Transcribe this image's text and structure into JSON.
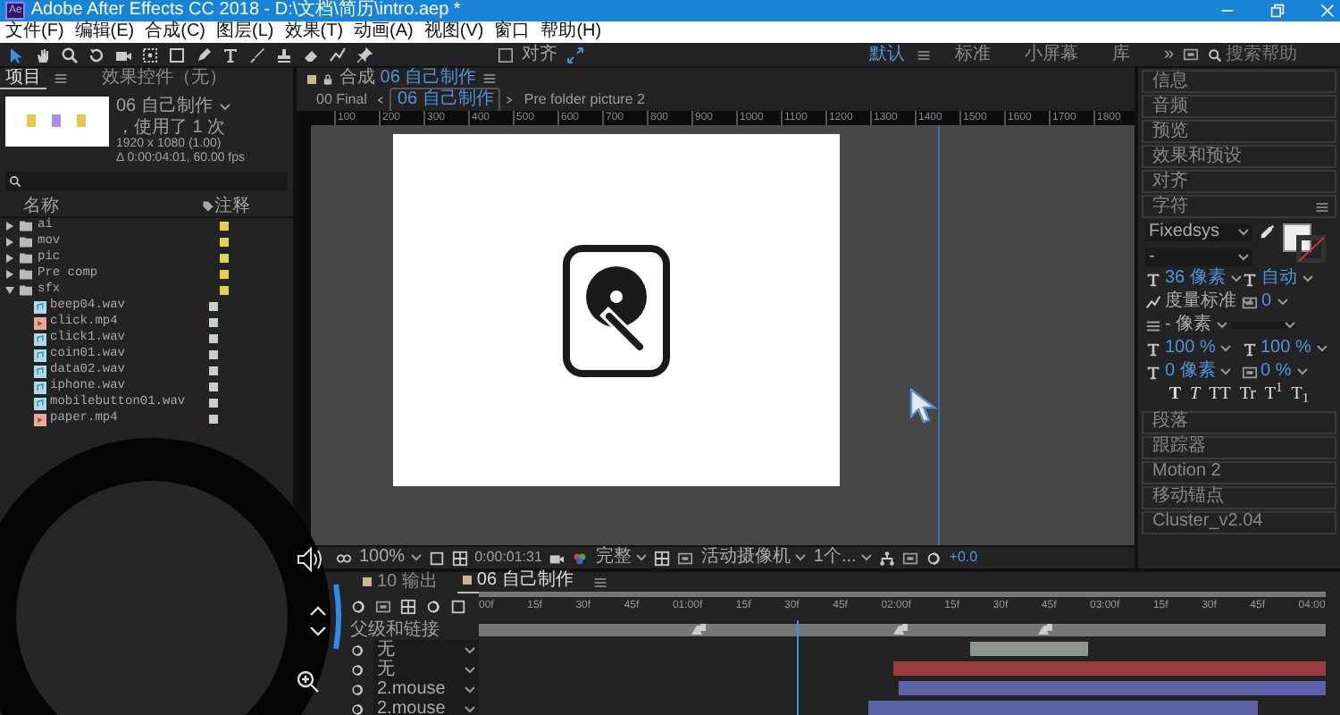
{
  "window": {
    "app_icon": "Ae",
    "title": "Adobe After Effects CC 2018 - D:\\文档\\简历\\intro.aep *"
  },
  "menu": [
    "文件(F)",
    "编辑(E)",
    "合成(C)",
    "图层(L)",
    "效果(T)",
    "动画(A)",
    "视图(V)",
    "窗口",
    "帮助(H)"
  ],
  "toolbar": {
    "snap": {
      "label": "对齐",
      "checked": false
    },
    "workspaces": [
      {
        "label": "默认",
        "selected": true
      },
      {
        "label": "标准",
        "selected": false
      },
      {
        "label": "小屏幕",
        "selected": false
      },
      {
        "label": "库",
        "selected": false
      }
    ],
    "more": "»",
    "search": {
      "placeholder": "搜索帮助"
    }
  },
  "project_panel": {
    "tabs": [
      {
        "label": "项目",
        "selected": true
      },
      {
        "label": "效果控件（无）",
        "selected": false
      }
    ],
    "info": {
      "name": "06 自己制作",
      "usage": "，使用了 1 次",
      "size": "1920 x 1080 (1.00)",
      "duration": "Δ 0:00:04:01, 60.00 fps"
    },
    "columns": [
      "名称",
      "注释"
    ],
    "items": [
      {
        "name": "ai",
        "kind": "folder",
        "expanded": false,
        "color": "#e0d24a"
      },
      {
        "name": "mov",
        "kind": "folder",
        "expanded": false,
        "color": "#e0d24a"
      },
      {
        "name": "pic",
        "kind": "folder",
        "expanded": false,
        "color": "#e0d24a"
      },
      {
        "name": "Pre comp",
        "kind": "folder",
        "expanded": false,
        "color": "#e0d24a"
      },
      {
        "name": "sfx",
        "kind": "folder",
        "expanded": true,
        "color": "#e0d24a",
        "children": [
          {
            "name": "beep04.wav",
            "kind": "audio",
            "color": "#c4d0d0"
          },
          {
            "name": "click.mp4",
            "kind": "video",
            "color": "#c4d0d0"
          },
          {
            "name": "click1.wav",
            "kind": "audio",
            "color": "#c4d0d0"
          },
          {
            "name": "coin01.wav",
            "kind": "audio",
            "color": "#c4d0d0"
          },
          {
            "name": "data02.wav",
            "kind": "audio",
            "color": "#c4d0d0"
          },
          {
            "name": "iphone.wav",
            "kind": "audio",
            "color": "#c4d0d0"
          },
          {
            "name": "mobilebutton01.wav",
            "kind": "audio",
            "color": "#c4d0d0"
          },
          {
            "name": "paper.mp4",
            "kind": "video",
            "color": "#c4d0d0"
          }
        ]
      }
    ]
  },
  "composition": {
    "tab": {
      "prefix": "合成",
      "name": "06 自己制作"
    },
    "breadcrumbs": [
      {
        "label": "00 Final",
        "selected": false
      },
      {
        "label": "06 自己制作",
        "selected": true
      },
      {
        "label": "Pre folder picture 2",
        "selected": false
      }
    ],
    "ruler": [
      "100",
      "200",
      "300",
      "400",
      "500",
      "600",
      "700",
      "800",
      "900",
      "1000",
      "1100",
      "1200",
      "1300",
      "1400",
      "1500",
      "1600",
      "1700",
      "1800"
    ],
    "viewer_toolbar": {
      "zoom": "100%",
      "time": "0:00:01:31",
      "resolution": "完整",
      "camera": "活动摄像机",
      "views": "1个...",
      "exposure": "+0.0"
    }
  },
  "right_panel": {
    "panels_before": [
      "信息",
      "音频",
      "预览",
      "效果和预设",
      "对齐"
    ],
    "character": {
      "title": "字符",
      "font": "Fixedsys",
      "style": "-",
      "size": "36 像素",
      "leading": "自动",
      "kerning": "度量标准",
      "tracking": "0",
      "stroke_width": "- 像素",
      "vertical_scale": "100 %",
      "horizontal_scale": "100 %",
      "baseline_shift": "0 像素",
      "tsume": "0 %",
      "style_buttons": [
        {
          "label": "T",
          "kind": "bold"
        },
        {
          "label": "T",
          "kind": "italic"
        },
        {
          "label": "TT",
          "kind": "plain"
        },
        {
          "label": "Tr",
          "kind": "plain"
        },
        {
          "label": "T$^{1}$",
          "kind": "plain"
        },
        {
          "label": "T$_{1}$",
          "kind": "plain"
        }
      ]
    },
    "panels_after": [
      "段落",
      "跟踪器",
      "Motion 2",
      "移动锚点",
      "Cluster_v2.04"
    ]
  },
  "timeline": {
    "tabs": [
      {
        "label": "10 输出",
        "selected": false
      },
      {
        "label": "06 自己制作",
        "selected": true
      }
    ],
    "ruler": [
      "00f",
      "15f",
      "30f",
      "45f",
      "01:00f",
      "15f",
      "30f",
      "45f",
      "02:00f",
      "15f",
      "30f",
      "45f",
      "03:00f",
      "15f",
      "30f",
      "45f",
      "04:00"
    ],
    "parent_header": "父级和链接",
    "layers": [
      {
        "parent": "无",
        "color": "#8c968c"
      },
      {
        "parent": "无",
        "color": "#9a3d3f"
      },
      {
        "parent": "2.mouse",
        "color": "#5b62a8"
      },
      {
        "parent": "2.mouse",
        "color": "#5b62a8"
      }
    ]
  }
}
